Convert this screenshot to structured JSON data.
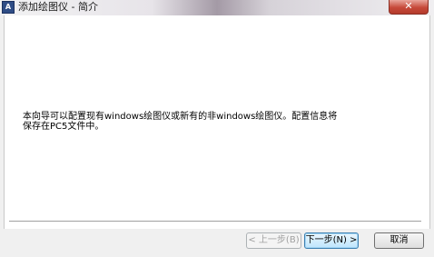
{
  "window": {
    "title": "添加绘图仪 - 简介",
    "icon": "plotter-app-icon",
    "icon_glyph": "A",
    "close_glyph": "✕"
  },
  "content": {
    "description_lines": [
      "本向导可以配置现有windows绘图仪或新有的非windows绘图仪。配置信息将",
      "保存在PC5文件中。"
    ]
  },
  "buttons": {
    "back": "< 上一步(B)",
    "next": "下一步(N) >",
    "cancel": "取消"
  },
  "colors": {
    "close_button": "#c74a3a",
    "default_button_border": "#3c7fb1"
  }
}
